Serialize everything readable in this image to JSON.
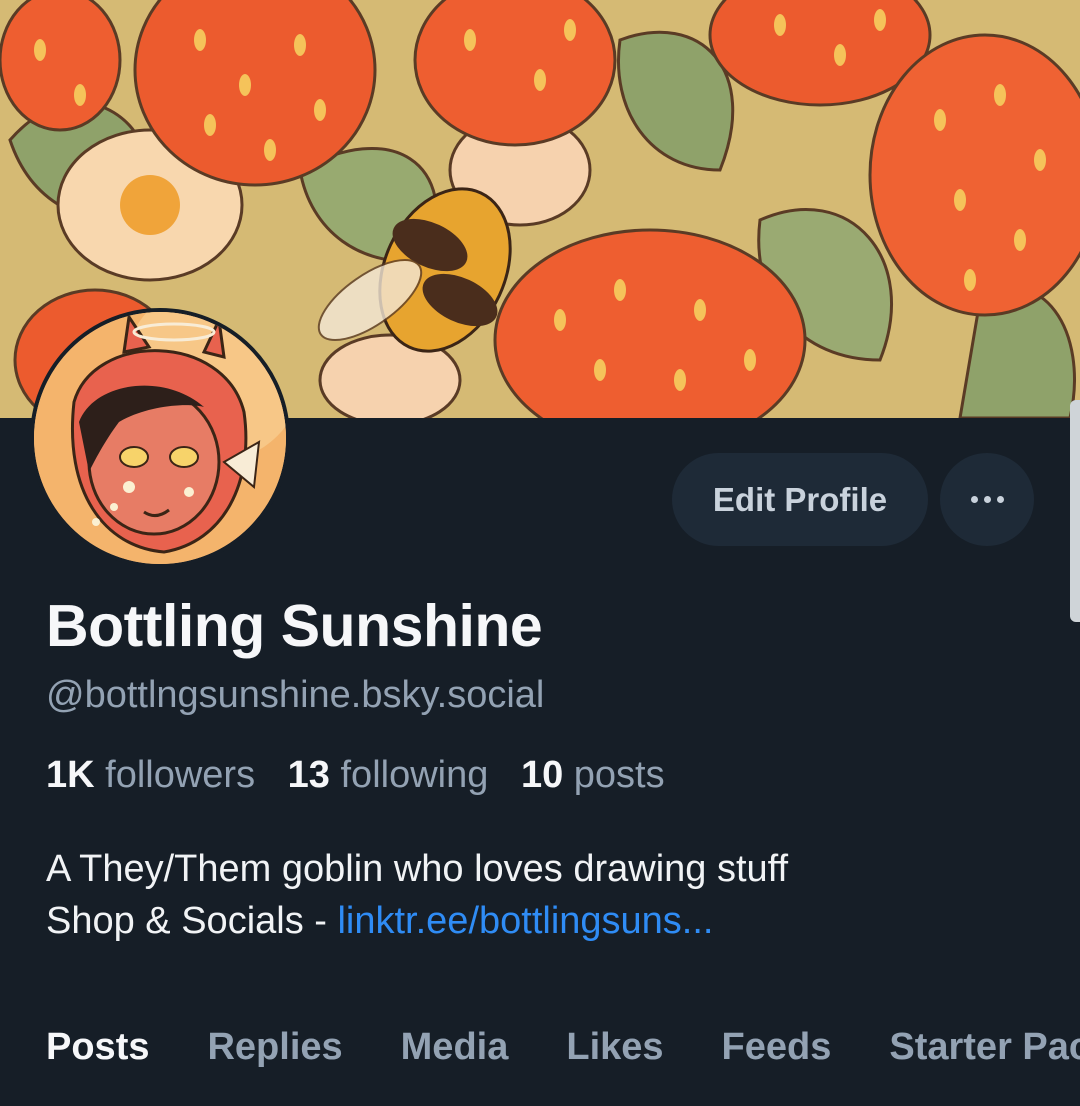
{
  "profile": {
    "display_name": "Bottling Sunshine",
    "handle": "@bottlngsunshine.bsky.social",
    "followers_count": "1K",
    "followers_label": "followers",
    "following_count": "13",
    "following_label": "following",
    "posts_count": "10",
    "posts_label": "posts",
    "bio_line1": "A They/Them goblin who loves drawing stuff",
    "bio_line2_prefix": "Shop & Socials - ",
    "bio_link": "linktr.ee/bottlingsuns..."
  },
  "actions": {
    "edit_label": "Edit Profile",
    "more_icon": "ellipsis-icon"
  },
  "tabs": [
    {
      "label": "Posts"
    },
    {
      "label": "Replies"
    },
    {
      "label": "Media"
    },
    {
      "label": "Likes"
    },
    {
      "label": "Feeds"
    },
    {
      "label": "Starter Packs"
    }
  ],
  "colors": {
    "background": "#161e27",
    "button": "#1e2a37",
    "link": "#2f8cf5",
    "muted": "#93a2b3"
  }
}
